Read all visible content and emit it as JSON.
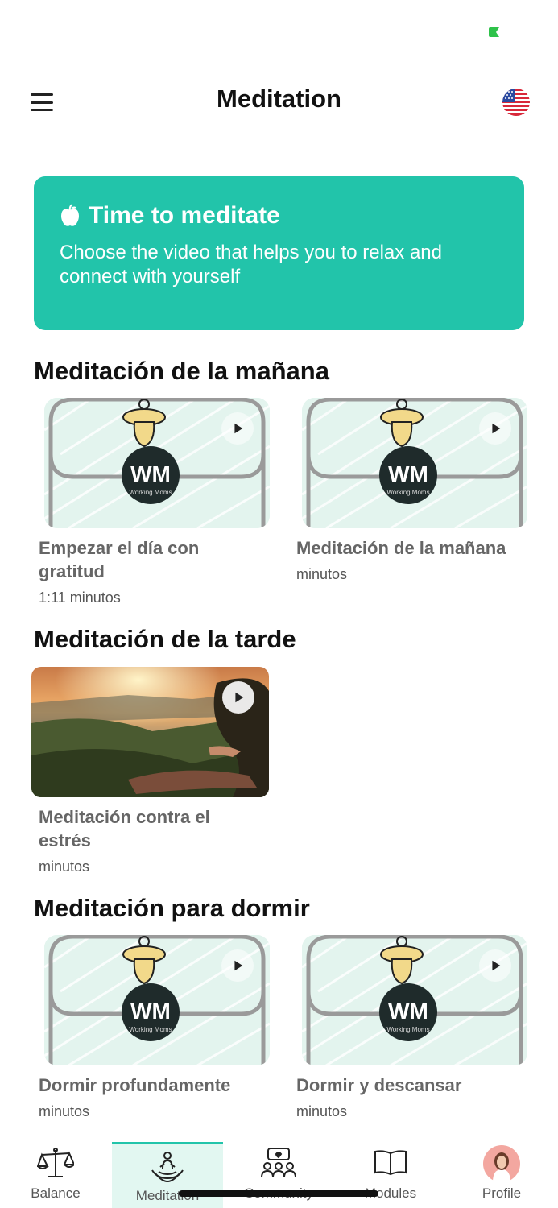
{
  "header": {
    "title": "Meditation",
    "menu_icon": "hamburger-menu-icon",
    "language_icon": "us-flag-icon"
  },
  "hero": {
    "icon": "apple-icon",
    "title": "Time to meditate",
    "subtitle": "Choose the video that helps you to relax and connect with yourself",
    "background_color": "#22c4aa"
  },
  "sections": [
    {
      "title": "Meditación de la mañana",
      "items": [
        {
          "title": "Empezar el día con gratitud",
          "duration": "1:11 minutos",
          "thumbnail": "working-moms-logo"
        },
        {
          "title": "Meditación de la mañana",
          "duration": "minutos",
          "thumbnail": "working-moms-logo"
        }
      ]
    },
    {
      "title": "Meditación de la tarde",
      "items": [
        {
          "title": "Meditación contra el estrés",
          "duration": "minutos",
          "thumbnail": "sunset-meditation-photo"
        }
      ]
    },
    {
      "title": "Meditación para dormir",
      "items": [
        {
          "title": "Dormir profundamente",
          "duration": "minutos",
          "thumbnail": "working-moms-logo"
        },
        {
          "title": "Dormir y descansar",
          "duration": "minutos",
          "thumbnail": "working-moms-logo"
        }
      ]
    }
  ],
  "logo_text": {
    "initials": "WM",
    "caption": "Working Moms"
  },
  "tab_bar": {
    "active": "Meditation",
    "accent_color": "#22c4aa",
    "tabs": [
      {
        "label": "Balance",
        "icon": "scale-icon"
      },
      {
        "label": "Meditation",
        "icon": "lotus-meditation-icon"
      },
      {
        "label": "Community",
        "icon": "community-chat-icon"
      },
      {
        "label": "Modules",
        "icon": "open-book-icon"
      },
      {
        "label": "Profile",
        "icon": "profile-avatar-icon"
      }
    ]
  }
}
